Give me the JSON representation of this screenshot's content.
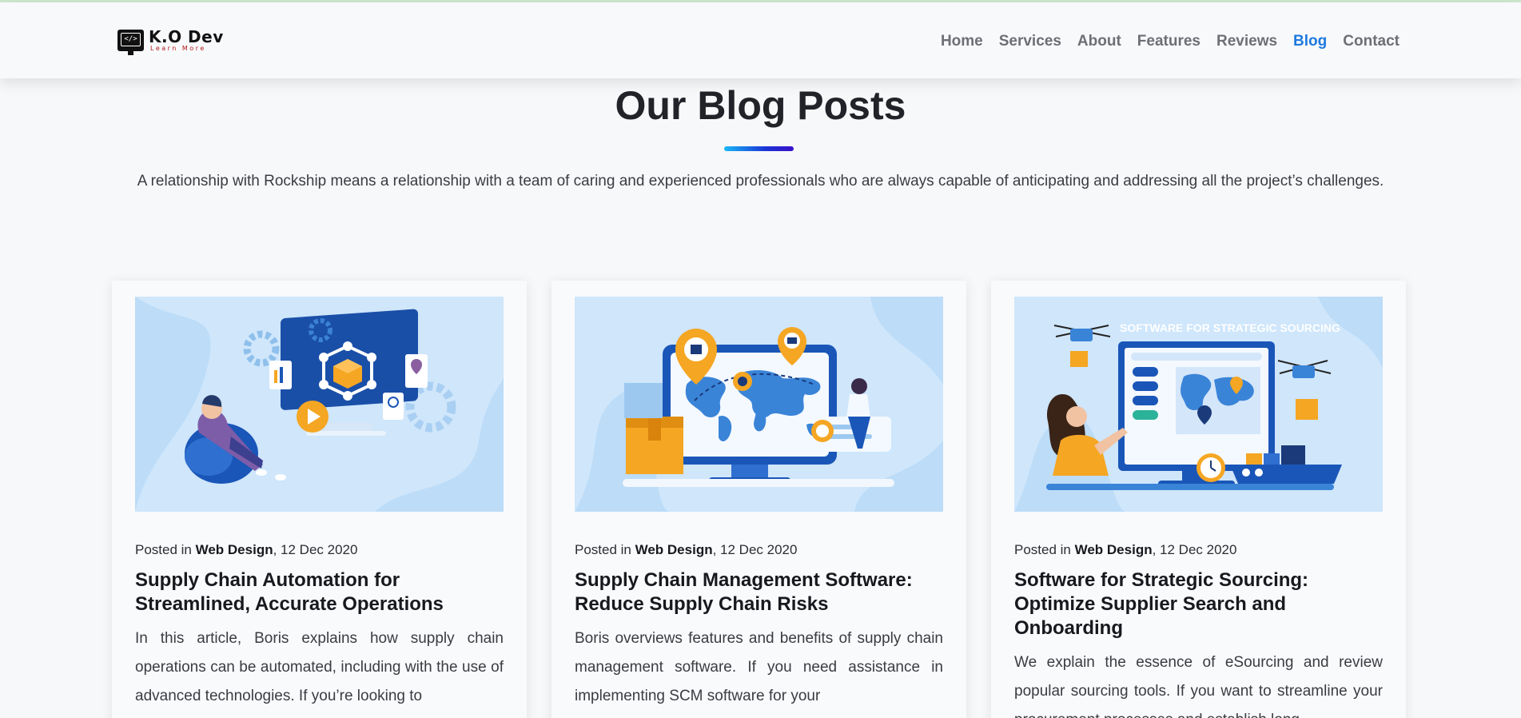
{
  "header": {
    "logo_name": "K.O Dev",
    "logo_tag": "Learn More",
    "nav": [
      {
        "label": "Home"
      },
      {
        "label": "Services"
      },
      {
        "label": "About"
      },
      {
        "label": "Features"
      },
      {
        "label": "Reviews"
      },
      {
        "label": "Blog",
        "active": true
      },
      {
        "label": "Contact"
      }
    ]
  },
  "section": {
    "title": "Our Blog Posts",
    "description": "A relationship with Rockship means a relationship with a team of caring and experienced professionals who are always capable of anticipating and addressing all the project’s challenges."
  },
  "posts": [
    {
      "posted_in_prefix": "Posted in ",
      "category": "Web Design",
      "date": ", 12 Dec 2020",
      "title": "Supply Chain Automation for Streamlined, Accurate Operations",
      "excerpt": "In this article, Boris explains how supply chain operations can be automated, including with the use of advanced technologies. If you’re looking to",
      "image_icon": "automation-illustration"
    },
    {
      "posted_in_prefix": "Posted in ",
      "category": "Web Design",
      "date": ", 12 Dec 2020",
      "title": "Supply Chain Management Software: Reduce Supply Chain Risks",
      "excerpt": "Boris overviews features and benefits of supply chain management software. If you need assistance in implementing SCM software for your",
      "image_icon": "world-map-illustration"
    },
    {
      "posted_in_prefix": "Posted in ",
      "category": "Web Design",
      "date": ", 12 Dec 2020",
      "title": "Software for Strategic Sourcing: Optimize Supplier Search and Onboarding",
      "excerpt": "We explain the essence of eSourcing and review popular sourcing tools. If you want to streamline your procurement processes and establish long",
      "image_caption": "SOFTWARE FOR STRATEGIC SOURCING",
      "image_icon": "sourcing-illustration"
    }
  ],
  "colors": {
    "accent": "#1f7ae0",
    "nav_text": "#6d6f75",
    "heading": "#212329",
    "illustration_bg": "#cfe6fb",
    "illustration_blue": "#1a56b8",
    "illustration_orange": "#f5a623"
  }
}
